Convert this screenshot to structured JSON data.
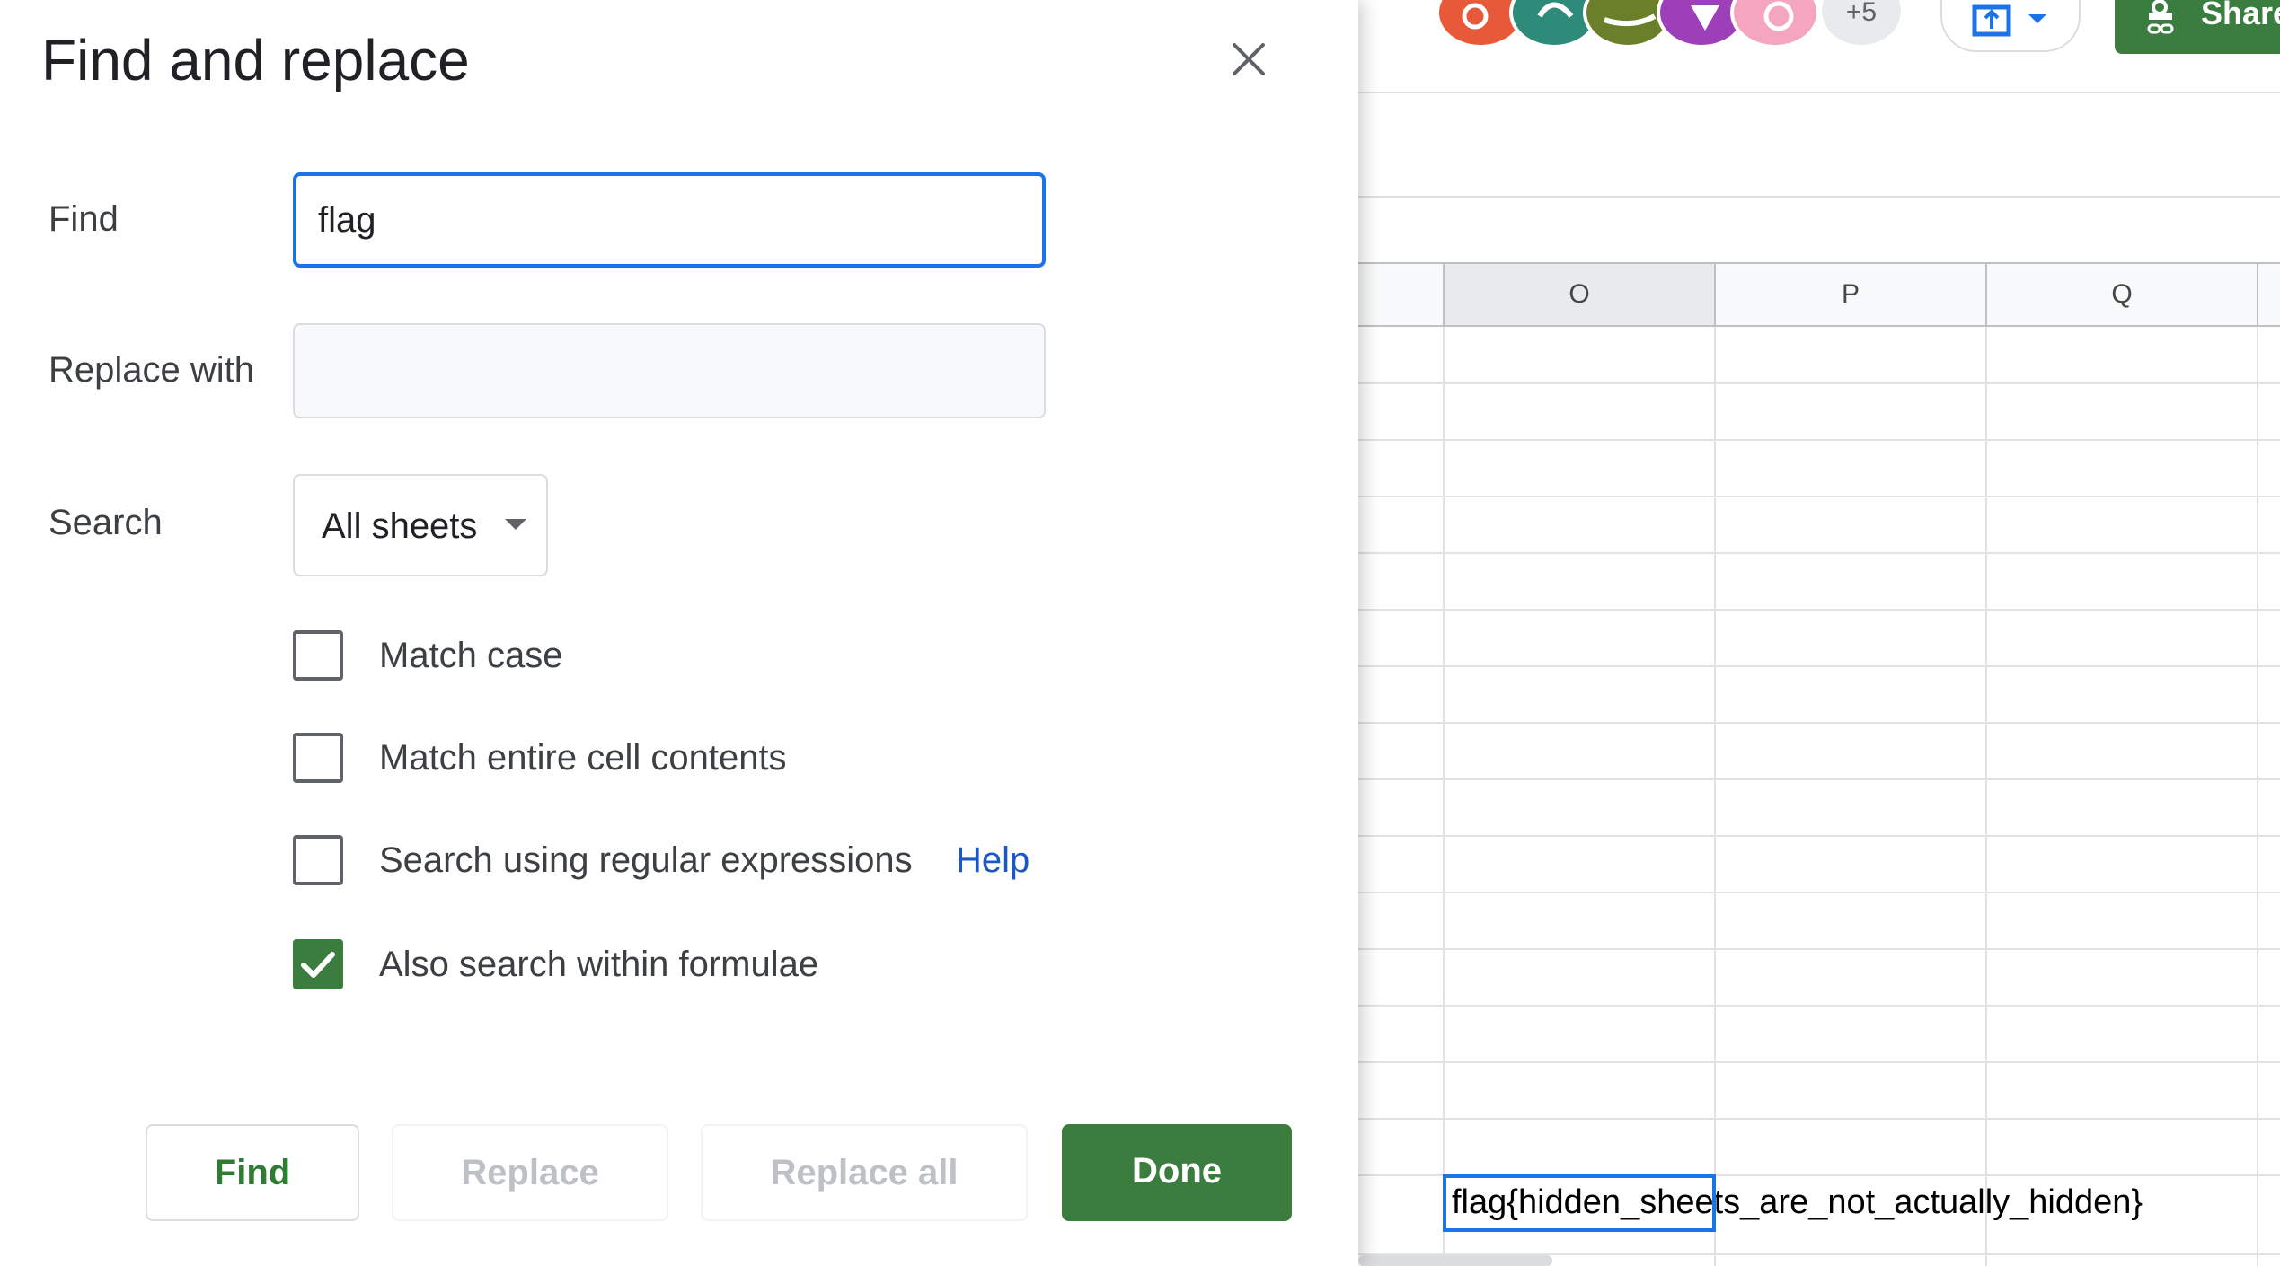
{
  "dialog": {
    "title": "Find and replace",
    "find_label": "Find",
    "find_value": "flag",
    "replace_label": "Replace with",
    "replace_value": "",
    "search_label": "Search",
    "search_scope": "All sheets",
    "options": [
      {
        "label": "Match case",
        "checked": false
      },
      {
        "label": "Match entire cell contents",
        "checked": false
      },
      {
        "label": "Search using regular expressions",
        "checked": false
      },
      {
        "label": "Also search within formulae",
        "checked": true
      }
    ],
    "help_link": "Help",
    "buttons": {
      "find": "Find",
      "replace": "Replace",
      "replace_all": "Replace all",
      "done": "Done"
    }
  },
  "sheet": {
    "columns": [
      "O",
      "P",
      "Q"
    ],
    "selected_cell_text": "flag{hidden_sheets_are_not_actually_hidden}",
    "collaborators_more": "+5",
    "share_label": "Share"
  },
  "colors": {
    "accent_green": "#3a7d3e",
    "focus_blue": "#1a73e8",
    "link_blue": "#1a57c9"
  }
}
